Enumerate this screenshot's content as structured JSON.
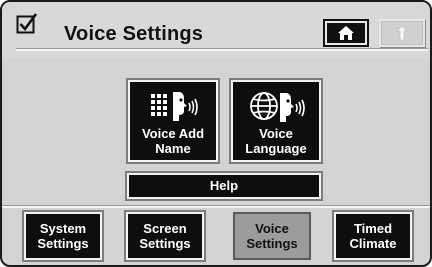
{
  "header": {
    "title": "Voice Settings",
    "check_icon": "checkbox-checked-icon",
    "home_icon": "home-icon",
    "back_icon": "back-arrow-icon"
  },
  "tiles": [
    {
      "label": "Voice Add Name",
      "line1": "Voice Add",
      "line2": "Name",
      "icon": "keypad-speaking-head-icon"
    },
    {
      "label": "Voice Language",
      "line1": "Voice",
      "line2": "Language",
      "icon": "globe-speaking-head-icon"
    }
  ],
  "help": {
    "label": "Help"
  },
  "tabs": [
    {
      "line1": "System",
      "line2": "Settings",
      "active": false
    },
    {
      "line1": "Screen",
      "line2": "Settings",
      "active": false
    },
    {
      "line1": "Voice",
      "line2": "Settings",
      "active": true
    },
    {
      "line1": "Timed",
      "line2": "Climate",
      "active": false
    }
  ],
  "colors": {
    "background": "#d3d3d3",
    "button": "#0e0e0e",
    "active_tab": "#9c9c9c",
    "text_light": "#ffffff"
  }
}
